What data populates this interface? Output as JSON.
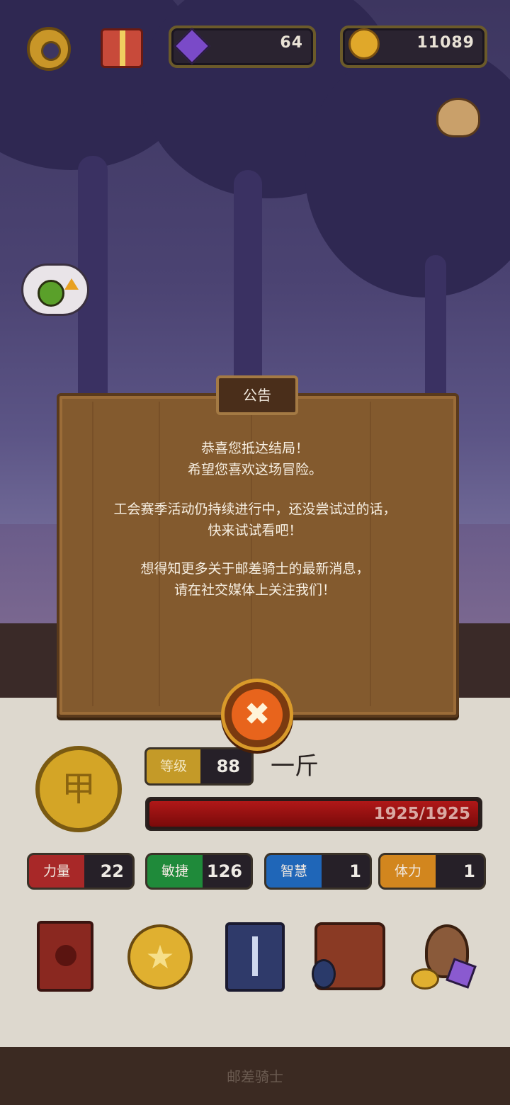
{
  "hud": {
    "gems": "64",
    "coins": "11089"
  },
  "dialog": {
    "title": "公告",
    "lines": [
      "恭喜您抵达结局！",
      "希望您喜欢这场冒险。",
      "工会赛季活动仍持续进行中，还没尝试过的话，",
      "快来试试看吧！",
      "想得知更多关于邮差骑士的最新消息，",
      "请在社交媒体上关注我们！"
    ]
  },
  "character": {
    "badge_glyph": "甲",
    "level_label": "等级",
    "level": "88",
    "name": "一斤",
    "hp": "1925/1925",
    "hp_fraction": 1.0
  },
  "stats": [
    {
      "label": "力量",
      "value": "22",
      "color": "#b12a2a"
    },
    {
      "label": "敏捷",
      "value": "126",
      "color": "#1f8a3a"
    },
    {
      "label": "智慧",
      "value": "1",
      "color": "#1f66b8"
    },
    {
      "label": "体力",
      "value": "1",
      "color": "#d2861e"
    }
  ],
  "menu_icons": [
    "skull-book-icon",
    "star-coin-icon",
    "sword-card-icon",
    "backpack-scroll-icon",
    "treasure-bag-icon"
  ],
  "footer": {
    "game_title": "邮差骑士"
  }
}
